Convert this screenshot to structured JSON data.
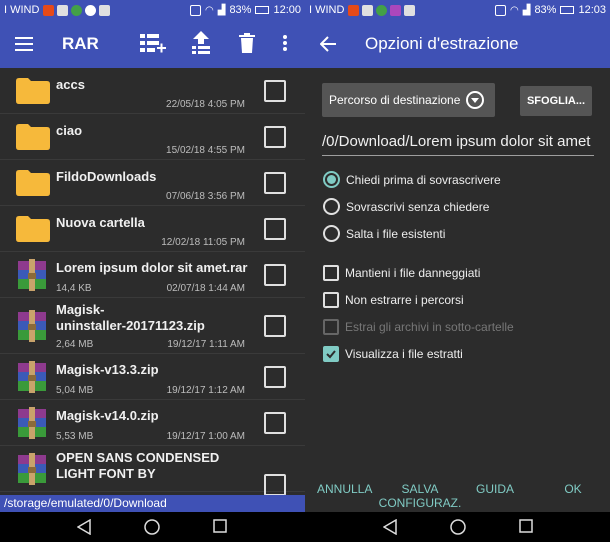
{
  "status_left": {
    "carrier": "I WIND",
    "battery": "83%",
    "time": "12:00"
  },
  "status_right": {
    "carrier": "I WIND",
    "battery": "83%",
    "time": "12:03"
  },
  "left_app": {
    "title": "RAR",
    "files": [
      {
        "name": "accs",
        "size": "",
        "date": "22/05/18 4:05 PM",
        "type": "folder"
      },
      {
        "name": "ciao",
        "size": "",
        "date": "15/02/18 4:55 PM",
        "type": "folder"
      },
      {
        "name": "FildoDownloads",
        "size": "",
        "date": "07/06/18 3:56 PM",
        "type": "folder"
      },
      {
        "name": "Nuova cartella",
        "size": "",
        "date": "12/02/18 11:05 PM",
        "type": "folder"
      },
      {
        "name": "Lorem ipsum dolor sit amet.rar",
        "size": "14,4 KB",
        "date": "02/07/18 1:44 AM",
        "type": "archive"
      },
      {
        "name": "Magisk-\nuninstaller-20171123.zip",
        "size": "2,64 MB",
        "date": "19/12/17 1:11 AM",
        "type": "archive"
      },
      {
        "name": "Magisk-v13.3.zip",
        "size": "5,04 MB",
        "date": "19/12/17 1:12 AM",
        "type": "archive"
      },
      {
        "name": "Magisk-v14.0.zip",
        "size": "5,53 MB",
        "date": "19/12/17 1:00 AM",
        "type": "archive"
      },
      {
        "name": "OPEN SANS CONDENSED\nLIGHT FONT BY",
        "size": "",
        "date": "",
        "type": "archive"
      }
    ],
    "path": "/storage/emulated/0/Download"
  },
  "right_app": {
    "title": "Opzioni d'estrazione",
    "destination_label": "Percorso di destinazione",
    "browse_label": "SFOGLIA...",
    "path_value": "/0/Download/Lorem ipsum dolor sit amet",
    "radios": [
      {
        "label": "Chiedi prima di sovrascrivere",
        "selected": true
      },
      {
        "label": "Sovrascrivi senza chiedere",
        "selected": false
      },
      {
        "label": "Salta i file esistenti",
        "selected": false
      }
    ],
    "checkboxes": [
      {
        "label": "Mantieni i file danneggiati",
        "checked": false,
        "disabled": false
      },
      {
        "label": "Non estrarre i percorsi",
        "checked": false,
        "disabled": false
      },
      {
        "label": "Estrai gli archivi in sotto-cartelle",
        "checked": false,
        "disabled": true
      },
      {
        "label": "Visualizza i file estratti",
        "checked": true,
        "disabled": false
      }
    ],
    "actions": {
      "cancel": "ANNULLA",
      "save": "SALVA\nCONFIGURAZ.",
      "help": "GUIDA",
      "ok": "OK"
    }
  },
  "colors": {
    "primary": "#3f51b5",
    "accent": "#80cbc4",
    "background": "#2c2c2c",
    "folder": "#f6b93b"
  }
}
